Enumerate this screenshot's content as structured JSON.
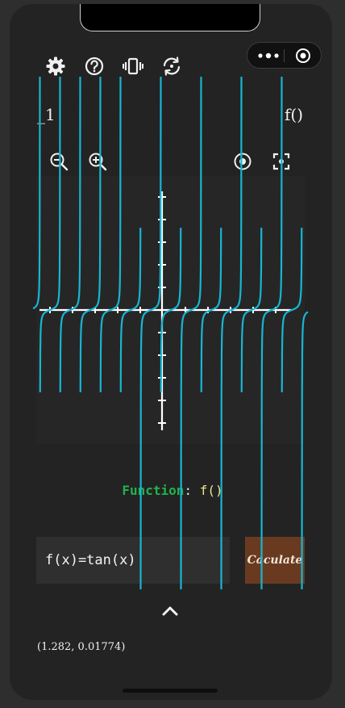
{
  "toolbar": {
    "icons": [
      "gear-icon",
      "help-icon",
      "vibrate-icon",
      "refresh-icon"
    ]
  },
  "capsule": {
    "icons": [
      "more-icon",
      "target-icon"
    ]
  },
  "header": {
    "left_title": "_1",
    "right_title": "f()"
  },
  "graph_controls": {
    "icons": [
      "zoom-out-icon",
      "zoom-in-icon",
      "center-icon",
      "fit-screen-icon"
    ]
  },
  "function_display": {
    "label": "Function",
    "separator": ":",
    "value": "f()"
  },
  "input": {
    "value": "f(x)=tan(x)"
  },
  "calculate_button": {
    "label": "Caculate"
  },
  "coordinates": {
    "text": "(1.282, 0.01774)"
  },
  "colors": {
    "curve": "#17b6d4",
    "axes": "#ffffff",
    "function_label": "#22b24c",
    "function_value": "#e7e78a",
    "button": "#6a3a20"
  }
}
